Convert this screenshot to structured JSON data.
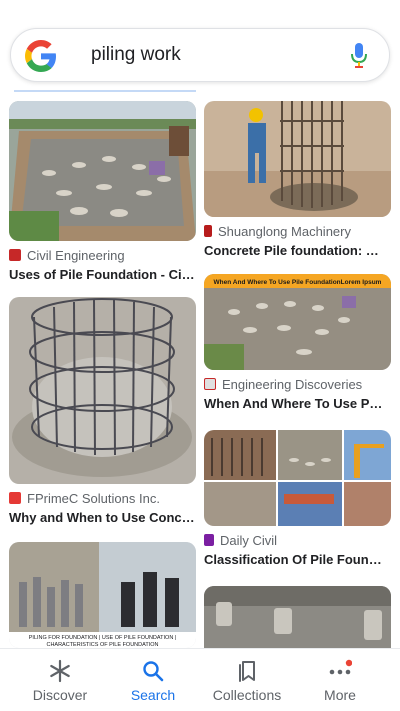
{
  "search": {
    "query": "piling work"
  },
  "results": [
    {
      "source": "Civil Engineering",
      "title": "Uses of Pile Foundation - Civi..."
    },
    {
      "source": "Shuanglong Machinery",
      "title": "Concrete Pile foundation: Diff..."
    },
    {
      "source": "Engineering Discoveries",
      "title": "When And Where To Use Pile ...",
      "banner": "When And Where To Use Pile FoundationLorem Ipsum"
    },
    {
      "source": "FPrimeC Solutions Inc.",
      "title": "Why and When to Use Concre..."
    },
    {
      "source": "Daily Civil",
      "title": "Classification Of Pile Foundat..."
    },
    {
      "caption_line1": "PILING FOR FOUNDATION | USE OF PILE FOUNDATION |",
      "caption_line2": "CHARACTERISTICS OF PILE FOUNDATION"
    }
  ],
  "nav": {
    "discover": "Discover",
    "search": "Search",
    "collections": "Collections",
    "more": "More"
  },
  "colors": {
    "accent": "#1a73e8",
    "notification_dot": "#ea4335"
  }
}
